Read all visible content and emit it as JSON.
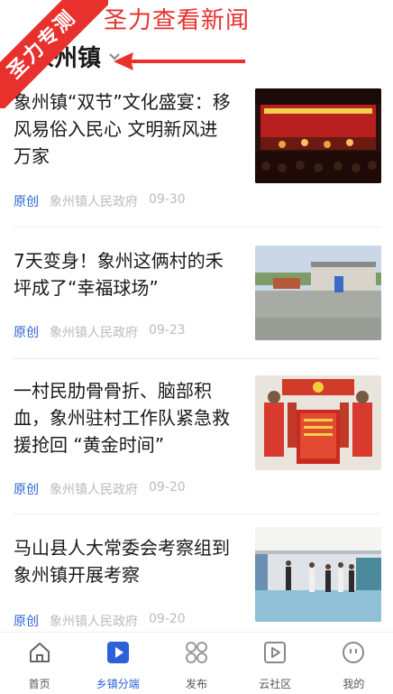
{
  "overlay": {
    "ribbon_text": "圣力专测",
    "caption": "圣力查看新闻"
  },
  "header": {
    "location": "象州镇"
  },
  "news": [
    {
      "title": "象州镇“双节”文化盛宴：移风易俗入民心 文明新风进万家",
      "tag": "原创",
      "source": "象州镇人民政府",
      "date": "09-30",
      "thumb": "stage-performance-photo"
    },
    {
      "title": "7天变身！象州这俩村的禾坪成了“幸福球场”",
      "tag": "原创",
      "source": "象州镇人民政府",
      "date": "09-23",
      "thumb": "village-court-photo"
    },
    {
      "title": "一村民肋骨骨折、脑部积血，象州驻村工作队紧急救援抢回 “黄金时间”",
      "tag": "原创",
      "source": "象州镇人民政府",
      "date": "09-20",
      "thumb": "banner-presentation-photo"
    },
    {
      "title": "马山县人大常委会考察组到象州镇开展考察",
      "tag": "原创",
      "source": "象州镇人民政府",
      "date": "09-20",
      "thumb": "inspection-visit-photo"
    }
  ],
  "tabs": [
    {
      "label": "首页",
      "icon": "home-icon",
      "active": false
    },
    {
      "label": "乡镇分端",
      "icon": "play-icon",
      "active": true
    },
    {
      "label": "发布",
      "icon": "grid-icon",
      "active": false
    },
    {
      "label": "云社区",
      "icon": "video-icon",
      "active": false
    },
    {
      "label": "我的",
      "icon": "profile-icon",
      "active": false
    }
  ],
  "colors": {
    "accent": "#2b62d8",
    "overlay_red": "#e8302c"
  }
}
